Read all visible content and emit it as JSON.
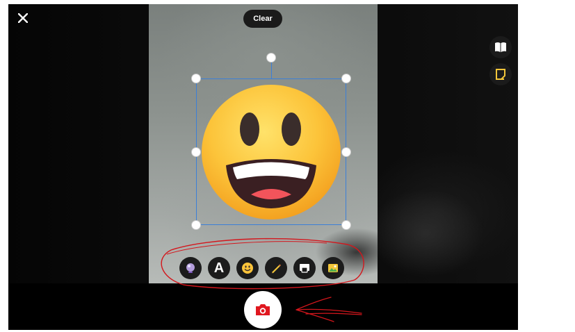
{
  "header": {
    "close_icon": "close-icon",
    "clear_label": "Clear"
  },
  "side_actions": [
    {
      "name": "book-icon"
    },
    {
      "name": "sticker-note-icon"
    }
  ],
  "overlay": {
    "emoji": "grinning-face-icon"
  },
  "toolbar": {
    "tools": [
      {
        "name": "filter-lens-icon"
      },
      {
        "name": "text-tool",
        "label": "A"
      },
      {
        "name": "emoji-sticker-icon"
      },
      {
        "name": "pencil-icon"
      },
      {
        "name": "background-icon"
      },
      {
        "name": "gallery-image-icon"
      }
    ]
  },
  "capture": {
    "icon": "camera-icon"
  },
  "colors": {
    "accent_selection": "#3b7fd8",
    "capture_icon": "#e0171f",
    "annotation": "#d4161c"
  }
}
